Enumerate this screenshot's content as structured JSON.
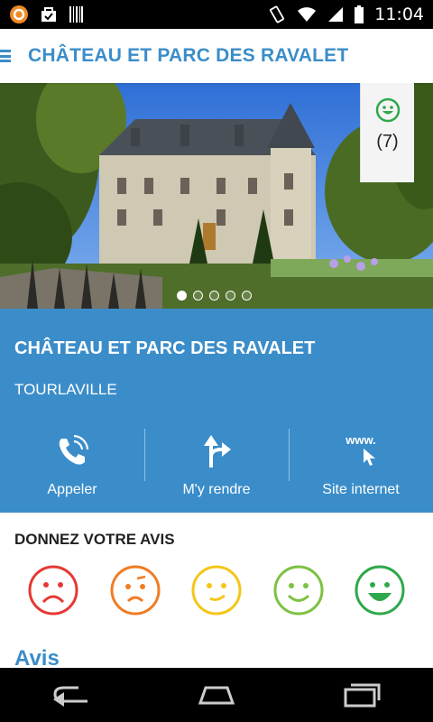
{
  "status_bar": {
    "time": "11:04"
  },
  "app_bar": {
    "title": "CHÂTEAU ET PARC DES RAVALET"
  },
  "hero": {
    "rating_count": "(7)",
    "slides": 5,
    "active_slide": 1
  },
  "info": {
    "title": "CHÂTEAU ET PARC DES RAVALET",
    "city": "TOURLAVILLE",
    "actions": [
      {
        "label": "Appeler",
        "icon": "phone-icon"
      },
      {
        "label": "M'y rendre",
        "icon": "directions-icon"
      },
      {
        "label": "Site internet",
        "icon": "www-icon",
        "icon_text": "www."
      }
    ]
  },
  "feedback": {
    "title": "DONNEZ VOTRE AVIS",
    "faces": [
      {
        "name": "very-unhappy-face-icon",
        "color": "#e53935"
      },
      {
        "name": "unhappy-face-icon",
        "color": "#f07c22"
      },
      {
        "name": "neutral-face-icon",
        "color": "#f5c518"
      },
      {
        "name": "happy-face-icon",
        "color": "#7cc242"
      },
      {
        "name": "very-happy-face-icon",
        "color": "#2ea84a"
      }
    ]
  },
  "reviews": {
    "title": "Avis"
  },
  "colors": {
    "accent": "#3b8dc9"
  }
}
